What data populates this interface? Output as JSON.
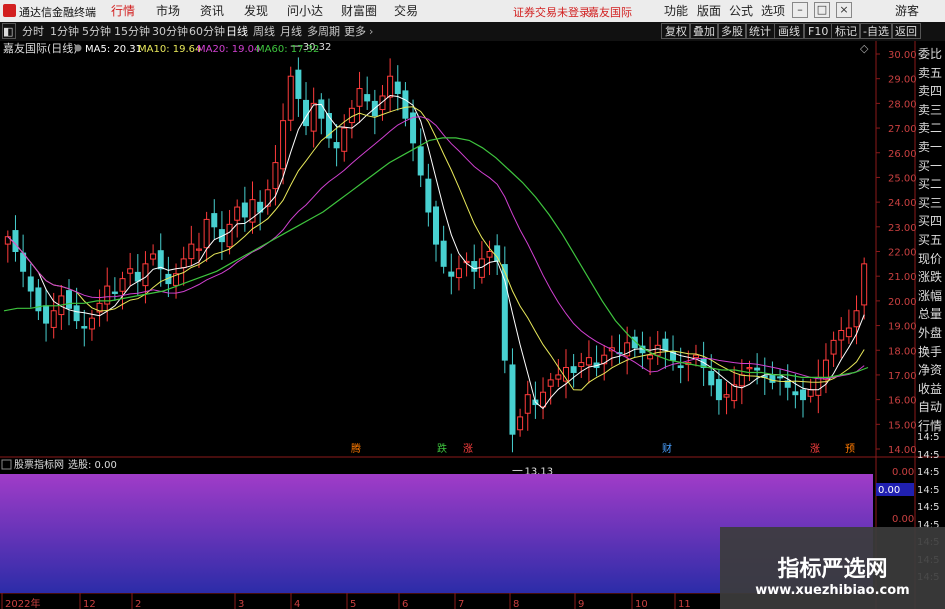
{
  "app": {
    "title": "通达信金融终端"
  },
  "menu": {
    "items": [
      {
        "label": "行情",
        "active": true
      },
      {
        "label": "市场"
      },
      {
        "label": "资讯"
      },
      {
        "label": "发现"
      },
      {
        "label": "问小达"
      },
      {
        "label": "财富圈"
      },
      {
        "label": "交易"
      }
    ],
    "notice_login": "证券交易未登录",
    "notice_stock": "嘉友国际",
    "right_items": [
      "功能",
      "版面",
      "公式",
      "选项"
    ],
    "guest": "游客"
  },
  "toolbar": {
    "periods": [
      {
        "label": "分时"
      },
      {
        "label": "1分钟"
      },
      {
        "label": "5分钟"
      },
      {
        "label": "15分钟"
      },
      {
        "label": "30分钟"
      },
      {
        "label": "60分钟"
      },
      {
        "label": "日线",
        "active": true
      },
      {
        "label": "周线"
      },
      {
        "label": "月线"
      },
      {
        "label": "多周期"
      },
      {
        "label": "更多"
      }
    ],
    "right_buttons": [
      "复权",
      "叠加",
      "多股",
      "统计",
      "画线",
      "F10",
      "标记",
      "-自选",
      "返回"
    ]
  },
  "chart_data": {
    "type": "candlestick",
    "title": "嘉友国际(日线)",
    "ma_legend": [
      {
        "name": "MA5",
        "value": "20.31",
        "color": "#ffffff"
      },
      {
        "name": "MA10",
        "value": "19.64",
        "color": "#e8e85a"
      },
      {
        "name": "MA20",
        "value": "19.04",
        "color": "#d040d0"
      },
      {
        "name": "MA60",
        "value": "17.32",
        "color": "#3ec43e"
      }
    ],
    "y_ticks": [
      "30.00",
      "29.00",
      "28.00",
      "27.00",
      "26.00",
      "25.00",
      "24.00",
      "23.00",
      "22.00",
      "21.00",
      "20.00",
      "19.00",
      "18.00",
      "17.00",
      "16.00",
      "15.00",
      "14.00"
    ],
    "ylim": [
      14,
      30
    ],
    "high_label": "30.32",
    "low_label": "13.13",
    "x_ticks": [
      "2022年",
      "12",
      "2",
      "3",
      "4",
      "5",
      "6",
      "7",
      "8",
      "9",
      "10",
      "11"
    ],
    "close": [
      22.6,
      22.0,
      21.2,
      20.4,
      19.6,
      19.1,
      19.6,
      20.2,
      19.7,
      19.2,
      18.9,
      19.3,
      19.9,
      20.6,
      20.3,
      20.9,
      21.3,
      20.8,
      21.5,
      21.9,
      21.3,
      20.7,
      21.1,
      21.7,
      22.3,
      22.1,
      23.3,
      23.0,
      22.4,
      23.1,
      23.8,
      23.4,
      24.1,
      23.6,
      24.5,
      25.6,
      27.3,
      29.1,
      28.2,
      27.1,
      28.0,
      27.4,
      26.6,
      26.2,
      27.0,
      27.8,
      28.6,
      28.1,
      27.5,
      28.3,
      29.1,
      28.4,
      27.4,
      26.4,
      25.1,
      23.6,
      22.3,
      21.4,
      21.0,
      21.3,
      21.6,
      21.2,
      21.7,
      22.0,
      21.6,
      17.6,
      14.6,
      15.3,
      16.2,
      15.8,
      16.3,
      16.8,
      17.0,
      17.3,
      17.1,
      17.5,
      17.7,
      17.3,
      17.8,
      18.1,
      17.9,
      18.3,
      18.1,
      17.9,
      17.8,
      18.2,
      18.0,
      17.6,
      17.3,
      17.5,
      17.8,
      17.3,
      16.6,
      16.0,
      16.2,
      16.6,
      17.0,
      17.3,
      17.2,
      16.9,
      16.7,
      16.9,
      16.5,
      16.2,
      16.0,
      16.4,
      16.9,
      17.6,
      18.4,
      18.8,
      18.9,
      19.6,
      21.5
    ],
    "ma60": [
      19.6,
      19.7,
      19.7,
      19.8,
      19.8,
      19.9,
      19.9,
      20.0,
      20.0,
      20.1,
      20.2,
      20.3,
      20.4,
      20.6,
      20.8,
      21.0,
      21.2,
      21.5,
      21.8,
      22.1,
      22.4,
      22.7,
      23.0,
      23.3,
      23.6,
      24.0,
      24.4,
      24.8,
      25.2,
      25.6,
      25.9,
      26.2,
      26.5,
      26.6,
      26.6,
      26.5,
      26.2,
      25.8,
      25.3,
      24.8,
      24.2,
      23.5,
      22.7,
      21.8,
      20.9,
      20.0,
      19.2,
      18.6,
      18.1,
      17.8,
      17.6,
      17.5,
      17.4,
      17.3,
      17.2,
      17.2,
      17.1,
      17.1,
      17.0,
      17.0,
      16.9,
      16.9,
      16.9,
      17.0,
      17.1,
      17.3
    ]
  },
  "event_markers": [
    {
      "label": "腾",
      "color": "#ff7a00"
    },
    {
      "label": "跌",
      "color": "#3ec43e"
    },
    {
      "label": "涨",
      "color": "#ff4040"
    },
    {
      "label": "财",
      "color": "#4aa0ff"
    },
    {
      "label": "涨",
      "color": "#ff4040"
    },
    {
      "label": "预",
      "color": "#ff7a00"
    }
  ],
  "right_panel": [
    "委比",
    "卖五",
    "卖四",
    "卖三",
    "卖二",
    "卖一",
    "买一",
    "买二",
    "买三",
    "买四",
    "买五",
    "现价",
    "涨跌",
    "涨幅",
    "总量",
    "外盘",
    "换手",
    "净资",
    "收益",
    "自动",
    "行情"
  ],
  "right_times": [
    "14:5",
    "14:5",
    "14:5",
    "14:5",
    "14:5",
    "14:5",
    "14:5",
    "14:5",
    "14:5"
  ],
  "indicator": {
    "name": "股票指标网",
    "value_label": "选股: 0.00",
    "ticks": [
      "0.00",
      "0.00",
      "0.00"
    ],
    "current": "0.00"
  },
  "watermark": {
    "title": "指标严选网",
    "url": "www.xuezhibiao.com"
  }
}
